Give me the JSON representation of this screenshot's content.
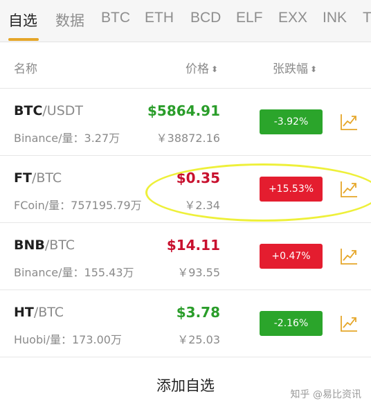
{
  "tabs": [
    "自选",
    "数据",
    "BTC",
    "ETH",
    "BCD",
    "ELF",
    "EXX",
    "INK",
    "T"
  ],
  "active_tab": "自选",
  "accent_color": "#e5a629",
  "header": {
    "name": "名称",
    "price": "价格",
    "change": "张跌幅"
  },
  "rows": [
    {
      "base": "BTC",
      "quote": "/USDT",
      "exchange_volume": "Binance/量：3.27万",
      "price": "$5864.91",
      "price_color": "up",
      "cny": "￥38872.16",
      "change": "-3.92%",
      "change_color": "green"
    },
    {
      "base": "FT",
      "quote": "/BTC",
      "exchange_volume": "FCoin/量：757195.79万",
      "price": "$0.35",
      "price_color": "down",
      "cny": "￥2.34",
      "change": "+15.53%",
      "change_color": "red"
    },
    {
      "base": "BNB",
      "quote": "/BTC",
      "exchange_volume": "Binance/量：155.43万",
      "price": "$14.11",
      "price_color": "down",
      "cny": "￥93.55",
      "change": "+0.47%",
      "change_color": "red"
    },
    {
      "base": "HT",
      "quote": "/BTC",
      "exchange_volume": "Huobi/量：173.00万",
      "price": "$3.78",
      "price_color": "up",
      "cny": "￥25.03",
      "change": "-2.16%",
      "change_color": "green"
    }
  ],
  "add_button": "添加自选",
  "watermark": "知乎 @易比资讯"
}
